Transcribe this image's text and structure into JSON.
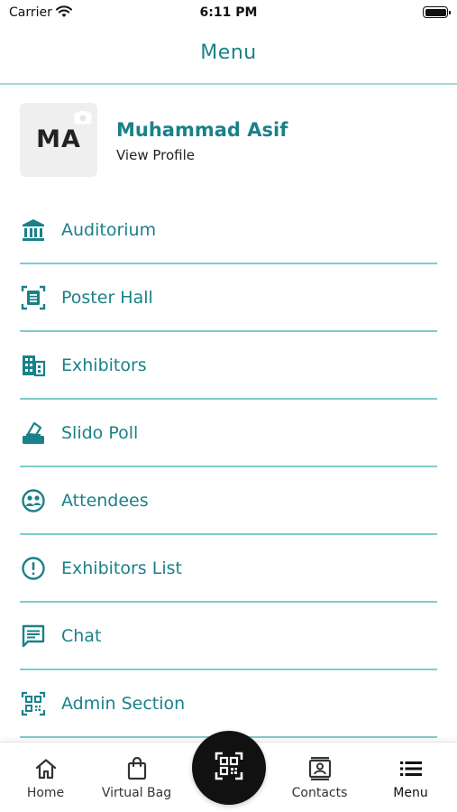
{
  "status_bar": {
    "carrier": "Carrier",
    "time": "6:11 PM"
  },
  "header": {
    "title": "Menu"
  },
  "profile": {
    "initials": "MA",
    "name": "Muhammad Asif",
    "link": "View Profile"
  },
  "menu": {
    "items": [
      {
        "label": "Auditorium",
        "icon": "auditorium-icon"
      },
      {
        "label": "Poster Hall",
        "icon": "poster-icon"
      },
      {
        "label": "Exhibitors",
        "icon": "building-icon"
      },
      {
        "label": "Slido Poll",
        "icon": "vote-icon"
      },
      {
        "label": "Attendees",
        "icon": "people-icon"
      },
      {
        "label": "Exhibitors List",
        "icon": "info-icon"
      },
      {
        "label": "Chat",
        "icon": "chat-icon"
      },
      {
        "label": "Admin Section",
        "icon": "qr-icon"
      }
    ]
  },
  "tab_bar": {
    "home": "Home",
    "bag": "Virtual Bag",
    "contacts": "Contacts",
    "menu": "Menu"
  },
  "colors": {
    "accent": "#1b8189",
    "divider": "#7fcbce",
    "scan_button": "#111111"
  }
}
